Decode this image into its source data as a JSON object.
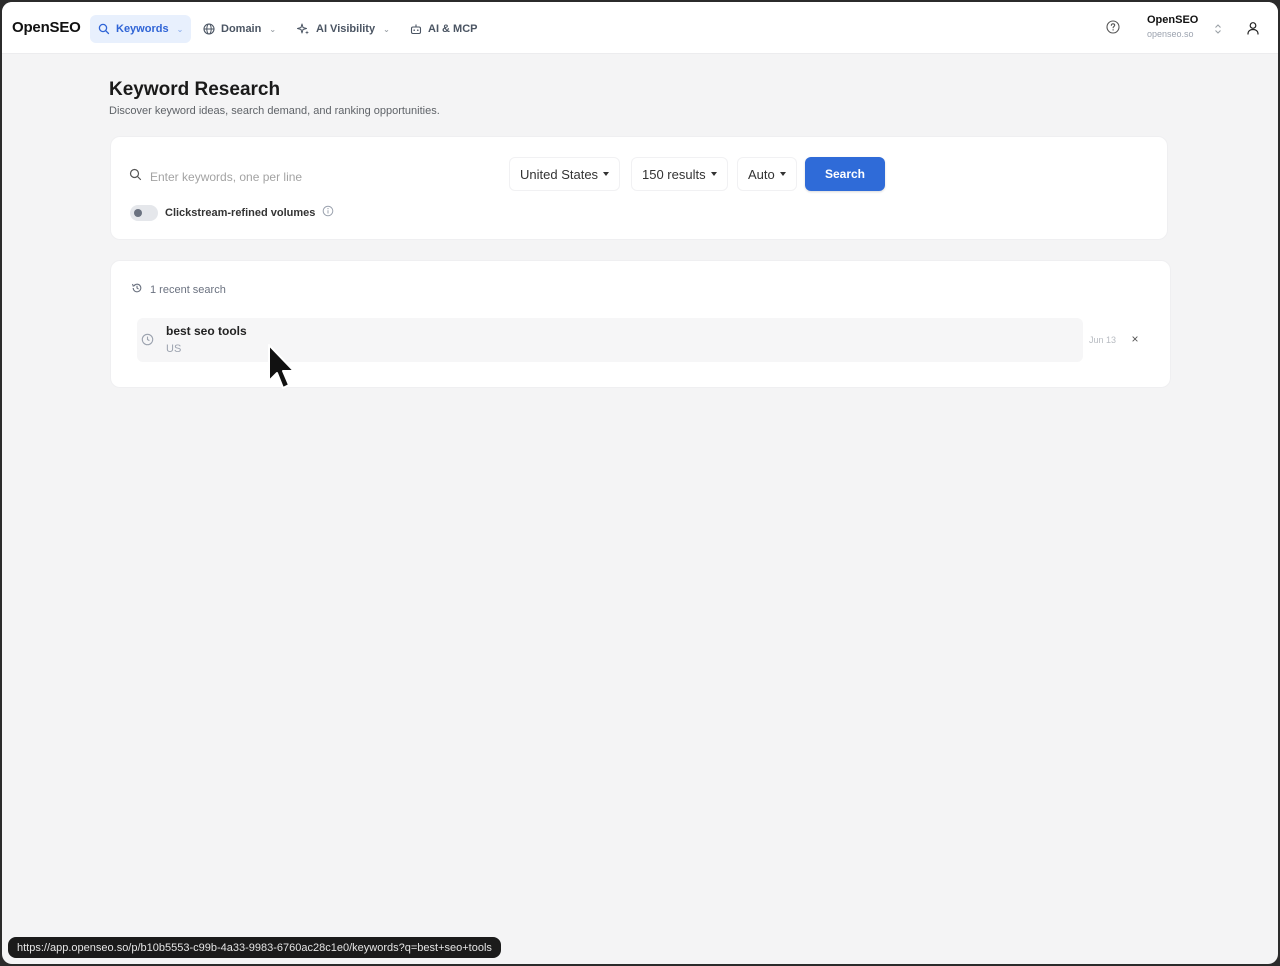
{
  "app": {
    "brand": "OpenSEO"
  },
  "nav": {
    "items": [
      {
        "label": "Keywords",
        "icon": "search-icon",
        "active": true
      },
      {
        "label": "Domain",
        "icon": "globe-icon",
        "active": false
      },
      {
        "label": "AI Visibility",
        "icon": "sparkles-icon",
        "active": false
      },
      {
        "label": "AI & MCP",
        "icon": "robot-icon",
        "active": false
      }
    ]
  },
  "org": {
    "name": "OpenSEO",
    "domain": "openseo.so"
  },
  "page": {
    "title": "Keyword Research",
    "subtitle": "Discover keyword ideas, search demand, and ranking opportunities."
  },
  "search": {
    "placeholder": "Enter keywords, one per line",
    "country": "United States",
    "results": "150 results",
    "mode": "Auto",
    "button": "Search",
    "toggle_label": "Clickstream-refined volumes",
    "toggle_on": false
  },
  "recent": {
    "heading": "1 recent search",
    "items": [
      {
        "keyword": "best seo tools",
        "location": "US",
        "date": "Jun 13"
      }
    ]
  },
  "status_bar": {
    "url": "https://app.openseo.so/p/b10b5553-c99b-4a33-9983-6760ac28c1e0/keywords?q=best+seo+tools"
  },
  "colors": {
    "accent": "#2f6bd8",
    "active_nav_bg": "#e8f0fd",
    "background": "#f4f4f5"
  }
}
